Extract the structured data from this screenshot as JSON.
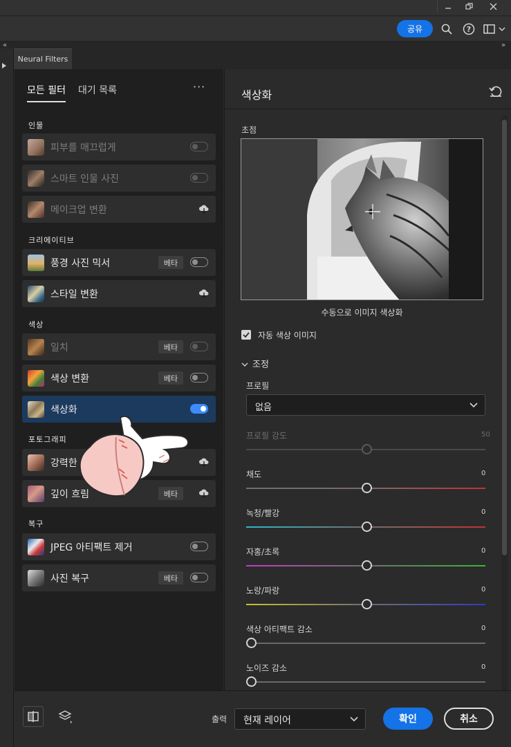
{
  "toolbar": {
    "share_label": "공유"
  },
  "tab": {
    "label": "Neural Filters"
  },
  "left_panel": {
    "tabs": [
      {
        "label": "모든 필터",
        "active": true
      },
      {
        "label": "대기 목록",
        "active": false
      }
    ],
    "more_label": "···",
    "beta_label": "베타",
    "categories": [
      {
        "label": "인물"
      },
      {
        "label": "크리에이티브"
      },
      {
        "label": "색상"
      },
      {
        "label": "포토그래피"
      },
      {
        "label": "복구"
      }
    ],
    "filters": [
      {
        "name": "피부를 매끄럽게",
        "control": "toggle",
        "state": "off",
        "dimmed": true
      },
      {
        "name": "스마트 인물 사진",
        "control": "toggle",
        "state": "off",
        "dimmed": true
      },
      {
        "name": "메이크업 변환",
        "control": "cloud",
        "dimmed": true
      },
      {
        "name": "풍경 사진 믹서",
        "control": "toggle",
        "state": "off",
        "beta": true
      },
      {
        "name": "스타일 변환",
        "control": "cloud"
      },
      {
        "name": "일치",
        "control": "toggle",
        "state": "off",
        "beta": true,
        "dimmed": true
      },
      {
        "name": "색상 변환",
        "control": "toggle",
        "state": "off",
        "beta": true
      },
      {
        "name": "색상화",
        "control": "toggle",
        "state": "on",
        "selected": true
      },
      {
        "name": "강력한",
        "control": "cloud"
      },
      {
        "name": "깊이 흐림",
        "control": "cloud",
        "beta": true
      },
      {
        "name": "JPEG 아티팩트 제거",
        "control": "toggle",
        "state": "off"
      },
      {
        "name": "사진 복구",
        "control": "toggle",
        "state": "off",
        "beta": true
      }
    ]
  },
  "right_panel": {
    "title": "색상화",
    "focus_label": "초점",
    "preview_caption": "수동으로 이미지 색상화",
    "auto_color_label": "자동 색상 이미지",
    "auto_color_checked": true,
    "adjust_section": "조정",
    "profile_label": "프로필",
    "profile_value": "없음",
    "sliders": [
      {
        "label": "프로필 강도",
        "value": "50",
        "dimmed": true,
        "position": 0.5
      },
      {
        "label": "채도",
        "value": "0",
        "position": 0.5
      },
      {
        "label": "녹청/빨강",
        "value": "0",
        "position": 0.5
      },
      {
        "label": "자홍/초록",
        "value": "0",
        "position": 0.5
      },
      {
        "label": "노랑/파랑",
        "value": "0",
        "position": 0.5
      },
      {
        "label": "색상 아티팩트 감소",
        "value": "0",
        "position": 0
      },
      {
        "label": "노이즈 감소",
        "value": "0",
        "position": 0
      }
    ]
  },
  "bottom_bar": {
    "output_label": "출력",
    "output_value": "현재 레이어",
    "ok_label": "확인",
    "cancel_label": "취소"
  },
  "colors": {
    "accent": "#1473e6",
    "selected_row": "#1c3a5e",
    "toggle_on": "#3d8bfd"
  }
}
